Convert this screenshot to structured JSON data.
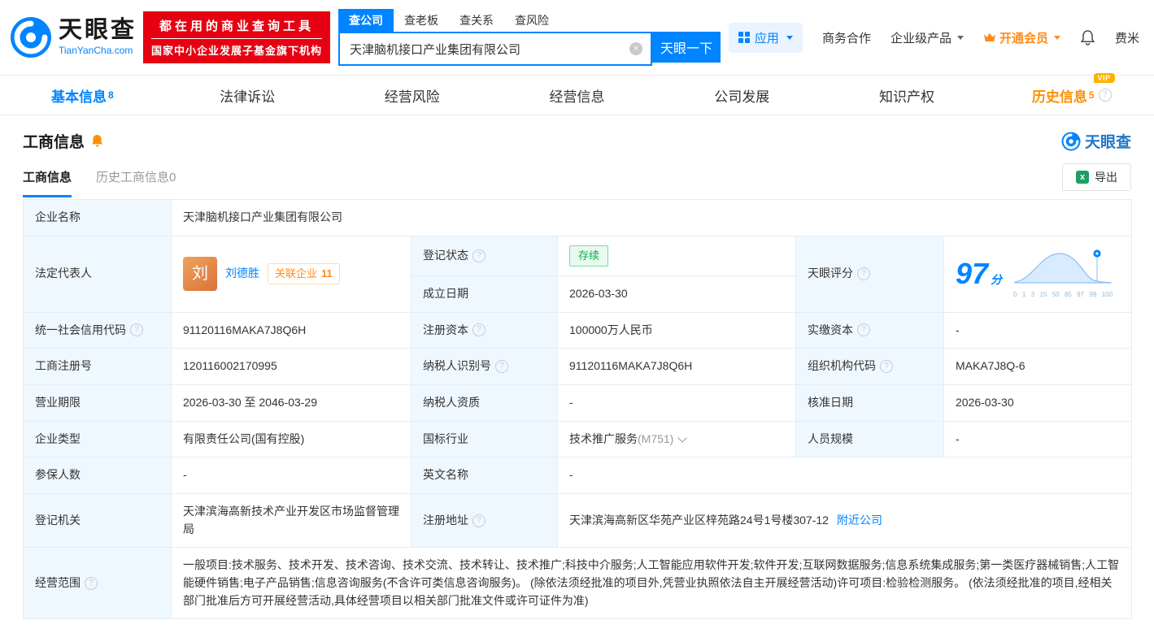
{
  "colors": {
    "brand_blue": "#0084ff",
    "badge_red": "#e60012",
    "vip_orange": "#ff8c19",
    "history_orange": "#ff9000",
    "status_green": "#00b34a"
  },
  "header": {
    "brand": "天眼查",
    "brand_domain": "TianYanCha.com",
    "slogan_line1": "都在用的商业查询工具",
    "slogan_line2": "国家中小企业发展子基金旗下机构",
    "search": {
      "tabs": [
        "查公司",
        "查老板",
        "查关系",
        "查风险"
      ],
      "query": "天津脑机接口产业集团有限公司",
      "button_label": "天眼一下"
    },
    "nav": {
      "apps": "应用",
      "cooperation": "商务合作",
      "enterprise": "企业级产品",
      "vip": "开通会员",
      "user": "费米"
    }
  },
  "main_tabs": [
    {
      "label": "基本信息",
      "count": "8"
    },
    {
      "label": "法律诉讼",
      "count": ""
    },
    {
      "label": "经营风险",
      "count": ""
    },
    {
      "label": "经营信息",
      "count": ""
    },
    {
      "label": "公司发展",
      "count": ""
    },
    {
      "label": "知识产权",
      "count": ""
    },
    {
      "label": "历史信息",
      "count": "5",
      "badge": "VIP"
    }
  ],
  "section": {
    "title": "工商信息",
    "brand_watermark": "天眼查",
    "subtabs": [
      {
        "label": "工商信息",
        "count": ""
      },
      {
        "label": "历史工商信息",
        "count": "0"
      }
    ],
    "export_label": "导出"
  },
  "info": {
    "company_name_label": "企业名称",
    "company_name": "天津脑机接口产业集团有限公司",
    "legal_rep_label": "法定代表人",
    "legal_rep_avatar": "刘",
    "legal_rep_name": "刘德胜",
    "related_companies_label": "关联企业",
    "related_companies_count": "11",
    "reg_status_label": "登记状态",
    "reg_status": "存续",
    "establish_date_label": "成立日期",
    "establish_date": "2026-03-30",
    "score_label": "天眼评分",
    "score_value": "97",
    "score_unit": "分",
    "score_axis": [
      "0",
      "1",
      "3",
      "15",
      "50",
      "85",
      "97",
      "99",
      "100"
    ],
    "credit_code_label": "统一社会信用代码",
    "credit_code": "91120116MAKA7J8Q6H",
    "reg_capital_label": "注册资本",
    "reg_capital": "100000万人民币",
    "paid_capital_label": "实缴资本",
    "paid_capital": "-",
    "reg_number_label": "工商注册号",
    "reg_number": "120116002170995",
    "taxpayer_id_label": "纳税人识别号",
    "taxpayer_id": "91120116MAKA7J8Q6H",
    "org_code_label": "组织机构代码",
    "org_code": "MAKA7J8Q-6",
    "business_term_label": "营业期限",
    "business_term": "2026-03-30 至 2046-03-29",
    "taxpayer_quality_label": "纳税人资质",
    "taxpayer_quality": "-",
    "approval_date_label": "核准日期",
    "approval_date": "2026-03-30",
    "company_type_label": "企业类型",
    "company_type": "有限责任公司(国有控股)",
    "industry_label": "国标行业",
    "industry": "技术推广服务",
    "industry_code": "(M751)",
    "staff_size_label": "人员规模",
    "staff_size": "-",
    "insured_label": "参保人数",
    "insured": "-",
    "english_name_label": "英文名称",
    "english_name": "-",
    "reg_authority_label": "登记机关",
    "reg_authority": "天津滨海高新技术产业开发区市场监督管理局",
    "reg_address_label": "注册地址",
    "reg_address": "天津滨海高新区华苑产业区梓苑路24号1号楼307-12",
    "nearby_label": "附近公司",
    "business_scope_label": "经营范围",
    "business_scope": "一般项目:技术服务、技术开发、技术咨询、技术交流、技术转让、技术推广;科技中介服务;人工智能应用软件开发;软件开发;互联网数据服务;信息系统集成服务;第一类医疗器械销售;人工智能硬件销售;电子产品销售;信息咨询服务(不含许可类信息咨询服务)。 (除依法须经批准的项目外,凭营业执照依法自主开展经营活动)许可项目:检验检测服务。 (依法须经批准的项目,经相关部门批准后方可开展经营活动,具体经营项目以相关部门批准文件或许可证件为准)"
  }
}
